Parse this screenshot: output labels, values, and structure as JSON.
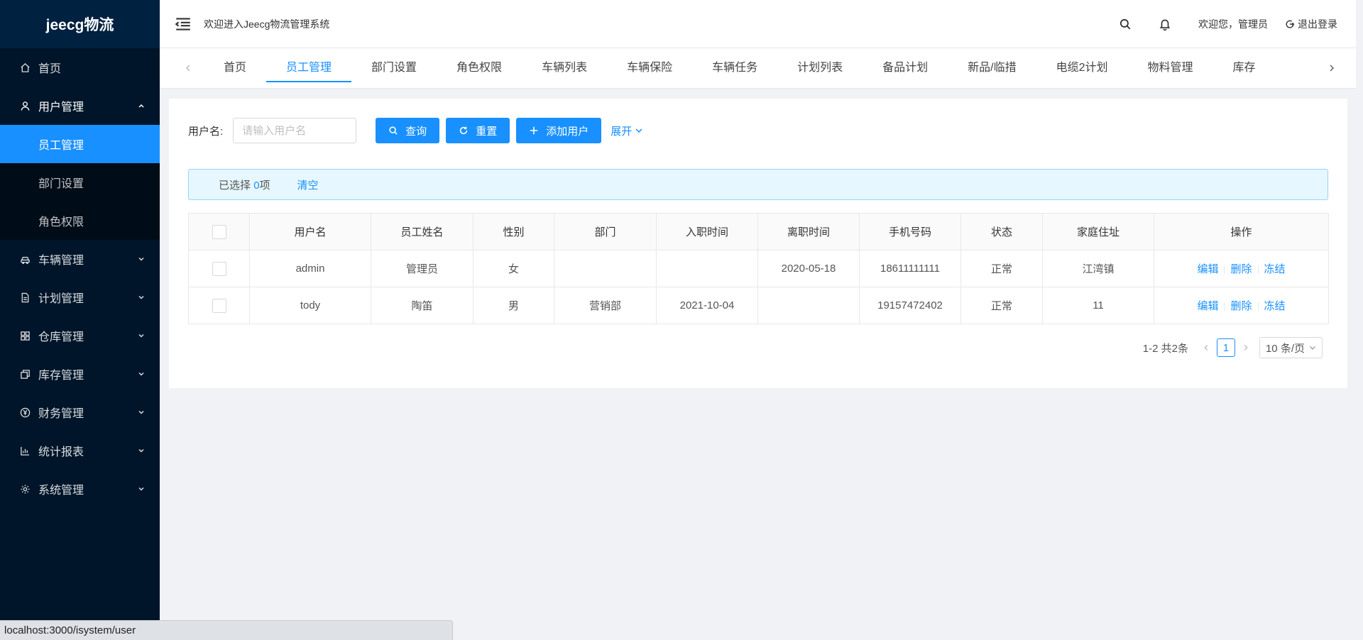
{
  "app": {
    "logo": "jeecg物流"
  },
  "sidebar": {
    "items": [
      {
        "label": "首页",
        "icon": "home-icon"
      },
      {
        "label": "用户管理",
        "icon": "user-icon",
        "open": true,
        "children": [
          {
            "label": "员工管理",
            "active": true
          },
          {
            "label": "部门设置"
          },
          {
            "label": "角色权限"
          }
        ]
      },
      {
        "label": "车辆管理",
        "icon": "car-icon"
      },
      {
        "label": "计划管理",
        "icon": "file-icon"
      },
      {
        "label": "仓库管理",
        "icon": "grid-icon"
      },
      {
        "label": "库存管理",
        "icon": "copy-icon"
      },
      {
        "label": "财务管理",
        "icon": "yen-icon"
      },
      {
        "label": "统计报表",
        "icon": "bar-chart-icon"
      },
      {
        "label": "系统管理",
        "icon": "gear-icon"
      }
    ]
  },
  "header": {
    "welcome": "欢迎进入Jeecg物流管理系统",
    "greeting": "欢迎您，管理员",
    "logout": "退出登录"
  },
  "tabs": [
    "首页",
    "员工管理",
    "部门设置",
    "角色权限",
    "车辆列表",
    "车辆保险",
    "车辆任务",
    "计划列表",
    "备品计划",
    "新品/临措",
    "电缆2计划",
    "物料管理",
    "库存"
  ],
  "active_tab": 1,
  "search": {
    "label": "用户名:",
    "placeholder": "请输入用户名",
    "value": "",
    "query_btn": "查询",
    "reset_btn": "重置",
    "add_btn": "添加用户",
    "expand": "展开"
  },
  "selection": {
    "prefix": "已选择",
    "count": "0",
    "suffix": "项",
    "clear": "清空"
  },
  "table": {
    "columns": [
      "用户名",
      "员工姓名",
      "性别",
      "部门",
      "入职时间",
      "离职时间",
      "手机号码",
      "状态",
      "家庭住址",
      "操作"
    ],
    "rows": [
      {
        "username": "admin",
        "name": "管理员",
        "gender": "女",
        "dept": "",
        "join": "",
        "leave": "2020-05-18",
        "phone": "18611111111",
        "status": "正常",
        "address": "江湾镇"
      },
      {
        "username": "tody",
        "name": "陶笛",
        "gender": "男",
        "dept": "营销部",
        "join": "2021-10-04",
        "leave": "",
        "phone": "19157472402",
        "status": "正常",
        "address": "11"
      }
    ],
    "ops": {
      "edit": "编辑",
      "delete": "删除",
      "freeze": "冻结"
    }
  },
  "pagination": {
    "total_text": "1-2 共2条",
    "current": "1",
    "page_size": "10 条/页"
  },
  "statusbar": {
    "url": "localhost:3000/isystem/user"
  },
  "colors": {
    "primary": "#1890ff",
    "sidebar": "#001529",
    "submenu": "#000c17"
  }
}
